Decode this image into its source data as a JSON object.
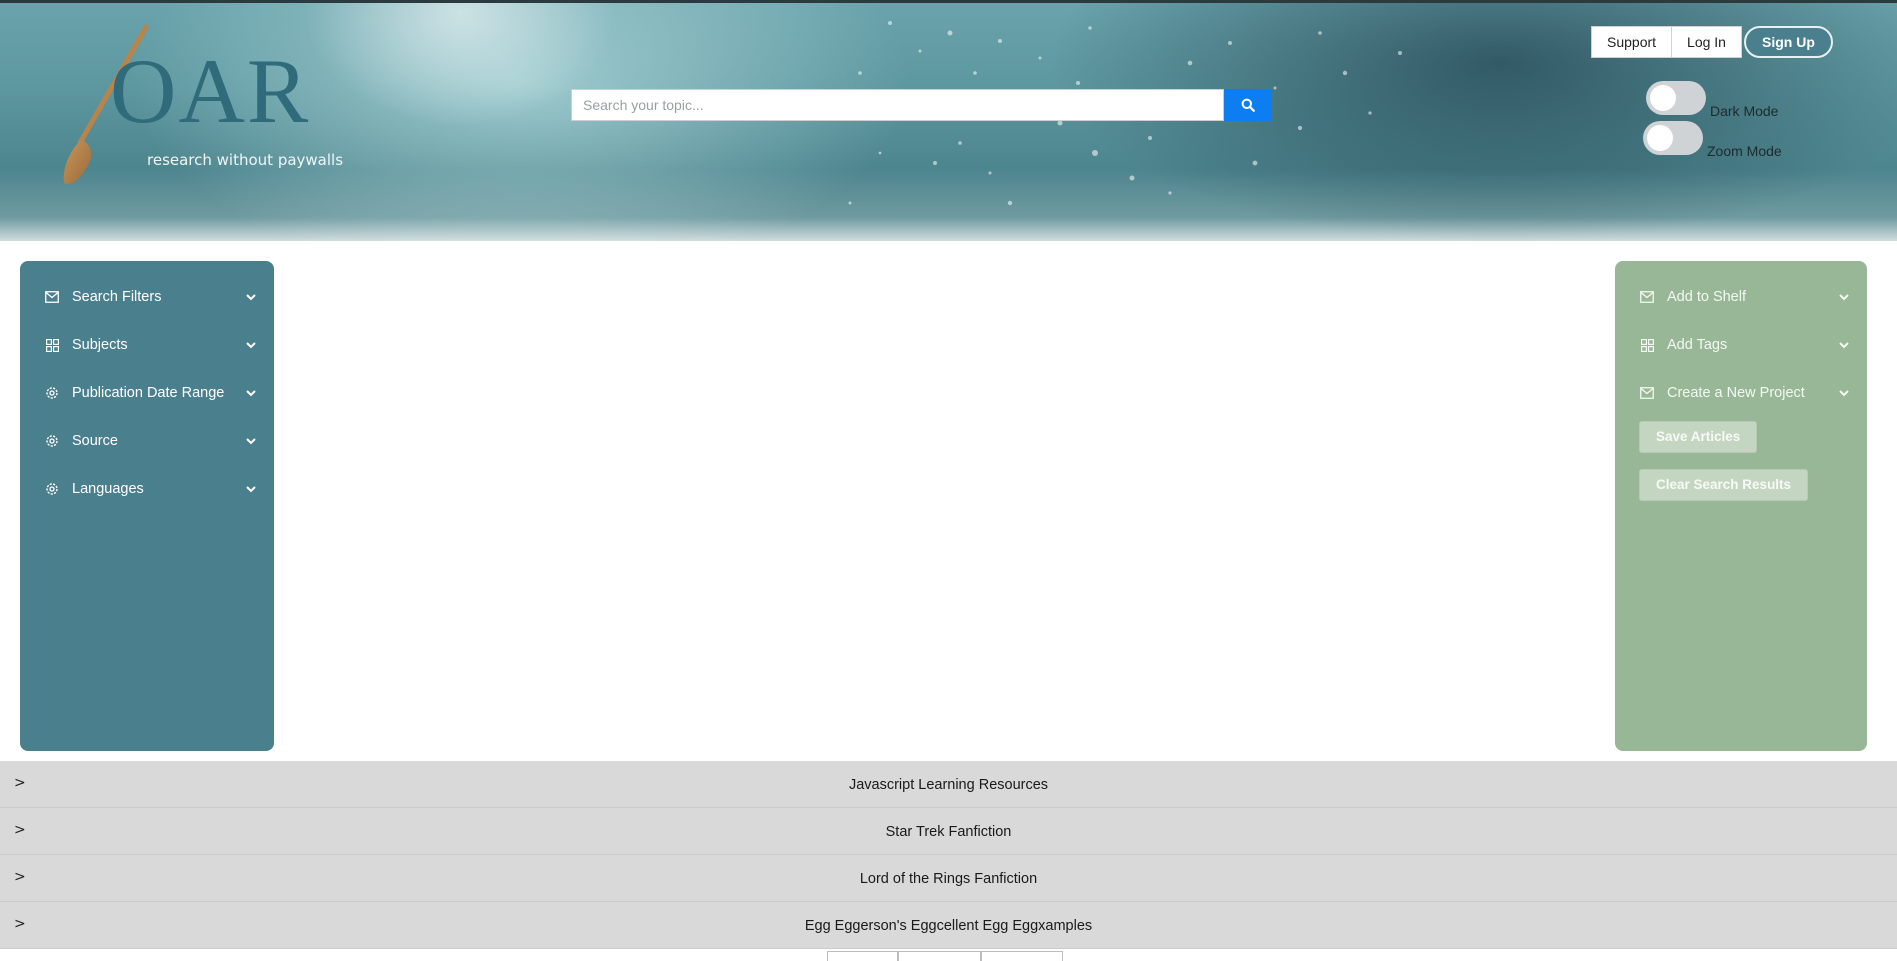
{
  "header": {
    "logo_text": "OAR",
    "tagline": "research without paywalls",
    "search": {
      "placeholder": "Search your topic..."
    },
    "auth": {
      "support": "Support",
      "login": "Log In",
      "signup": "Sign Up"
    },
    "toggles": {
      "dark_mode": "Dark Mode",
      "zoom_mode": "Zoom Mode"
    }
  },
  "left_sidebar": {
    "items": [
      {
        "label": "Search Filters",
        "icon": "mail-icon"
      },
      {
        "label": "Subjects",
        "icon": "grid-icon"
      },
      {
        "label": "Publication Date Range",
        "icon": "gear-icon"
      },
      {
        "label": "Source",
        "icon": "gear-icon"
      },
      {
        "label": "Languages",
        "icon": "gear-icon"
      }
    ]
  },
  "right_sidebar": {
    "items": [
      {
        "label": "Add to Shelf",
        "icon": "mail-icon"
      },
      {
        "label": "Add Tags",
        "icon": "grid-icon"
      },
      {
        "label": "Create a New Project",
        "icon": "mail-icon"
      }
    ],
    "save_articles": "Save Articles",
    "clear_results": "Clear Search Results"
  },
  "shelves": [
    {
      "caret": ">",
      "title": "Javascript Learning Resources"
    },
    {
      "caret": ">",
      "title": "Star Trek Fanfiction"
    },
    {
      "caret": ">",
      "title": "Lord of the Rings Fanfiction"
    },
    {
      "caret": ">",
      "title": "Egg Eggerson's Eggcellent Egg Eggxamples"
    }
  ],
  "colors": {
    "left_sidebar": "#4a7f8d",
    "right_sidebar": "#98b797",
    "search_button": "#0d7df2",
    "shelf_row": "#d9d9d9"
  }
}
